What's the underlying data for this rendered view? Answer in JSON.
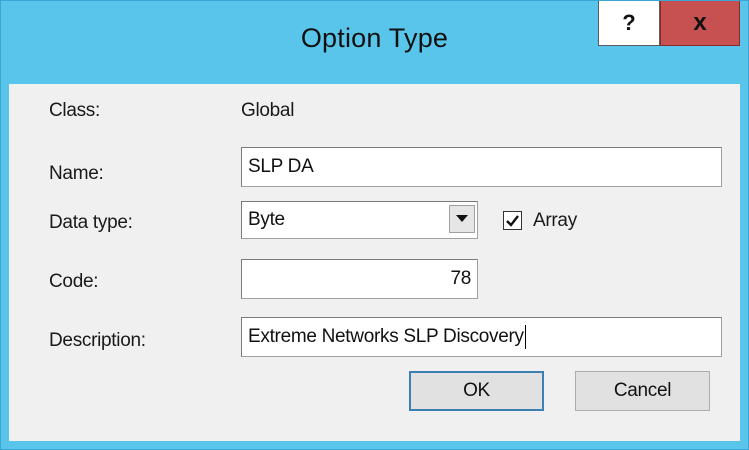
{
  "window": {
    "title": "Option Type",
    "help_label": "?",
    "close_label": "x"
  },
  "form": {
    "class_label": "Class:",
    "class_value": "Global",
    "name_label": "Name:",
    "name_value": "SLP DA",
    "datatype_label": "Data type:",
    "datatype_value": "Byte",
    "array_label": "Array",
    "array_checked": true,
    "code_label": "Code:",
    "code_value": "78",
    "description_label": "Description:",
    "description_value": "Extreme Networks SLP Discovery"
  },
  "buttons": {
    "ok_label": "OK",
    "cancel_label": "Cancel"
  },
  "colors": {
    "titlebar": "#5ac5ea",
    "close_button": "#c75050",
    "dialog_background": "#f0f0f0"
  }
}
